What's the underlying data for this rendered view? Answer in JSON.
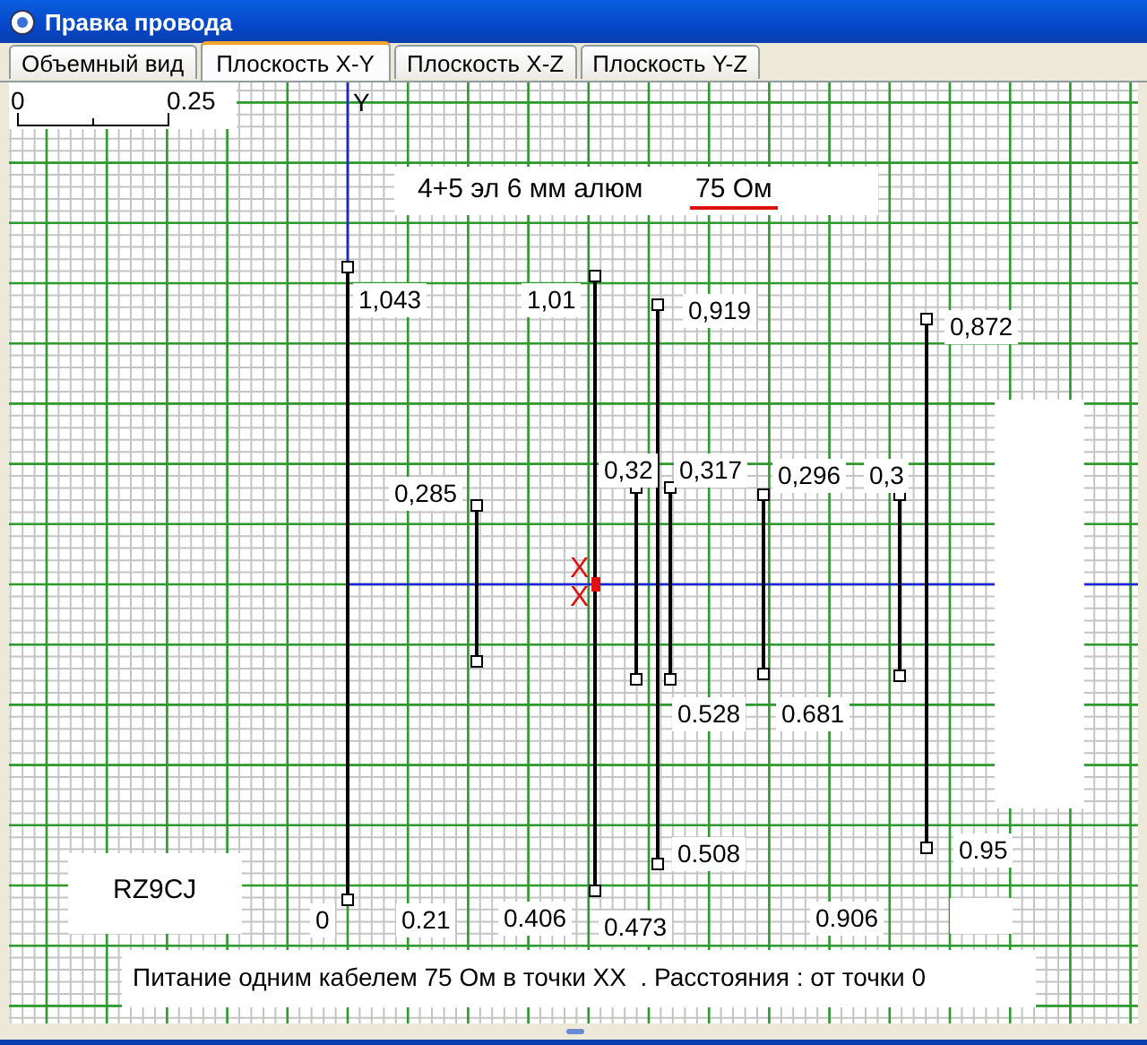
{
  "window": {
    "title": "Правка провода"
  },
  "tabs": [
    {
      "label": "Объемный вид",
      "selected": false
    },
    {
      "label": "Плоскость X-Y",
      "selected": true
    },
    {
      "label": "Плоскость X-Z",
      "selected": false
    },
    {
      "label": "Плоскость Y-Z",
      "selected": false
    }
  ],
  "scale": {
    "start": "0",
    "end": "0.25"
  },
  "axis_label": "Y",
  "heading": {
    "text": "4+5 эл 6 мм алюм",
    "impedance": "75 Ом"
  },
  "feed_marks": [
    "X",
    "X"
  ],
  "labels": [
    {
      "text": "1,043"
    },
    {
      "text": "1,01"
    },
    {
      "text": "0,919"
    },
    {
      "text": "0,872"
    },
    {
      "text": "0,285"
    },
    {
      "text": "0,32"
    },
    {
      "text": "0,317"
    },
    {
      "text": "0,296"
    },
    {
      "text": "0,3"
    },
    {
      "text": "0.528"
    },
    {
      "text": "0.681"
    },
    {
      "text": "0.508"
    },
    {
      "text": "0.95"
    },
    {
      "text": "0"
    },
    {
      "text": "0.21"
    },
    {
      "text": "0.406"
    },
    {
      "text": "0.473"
    },
    {
      "text": "0.906"
    }
  ],
  "callsign": "RZ9CJ",
  "note": "Питание одним кабелем 75 Ом в точки XX  . Расстояния : от точки 0"
}
